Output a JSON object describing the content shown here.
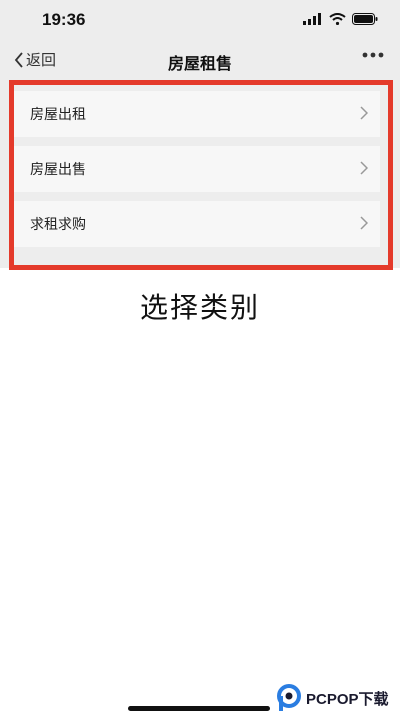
{
  "status_bar": {
    "time": "19:36",
    "icons": [
      "signal-icon",
      "wifi-icon",
      "battery-icon"
    ]
  },
  "nav": {
    "back_label": "返回",
    "title": "房屋租售",
    "more_icon": "more-icon"
  },
  "menu": {
    "items": [
      {
        "label": "房屋出租"
      },
      {
        "label": "房屋出售"
      },
      {
        "label": "求租求购"
      }
    ]
  },
  "caption": "选择类别",
  "watermark": {
    "text": "PCPOP下载"
  },
  "colors": {
    "highlight_frame": "#e43a2b",
    "nav_background": "#ededed"
  }
}
